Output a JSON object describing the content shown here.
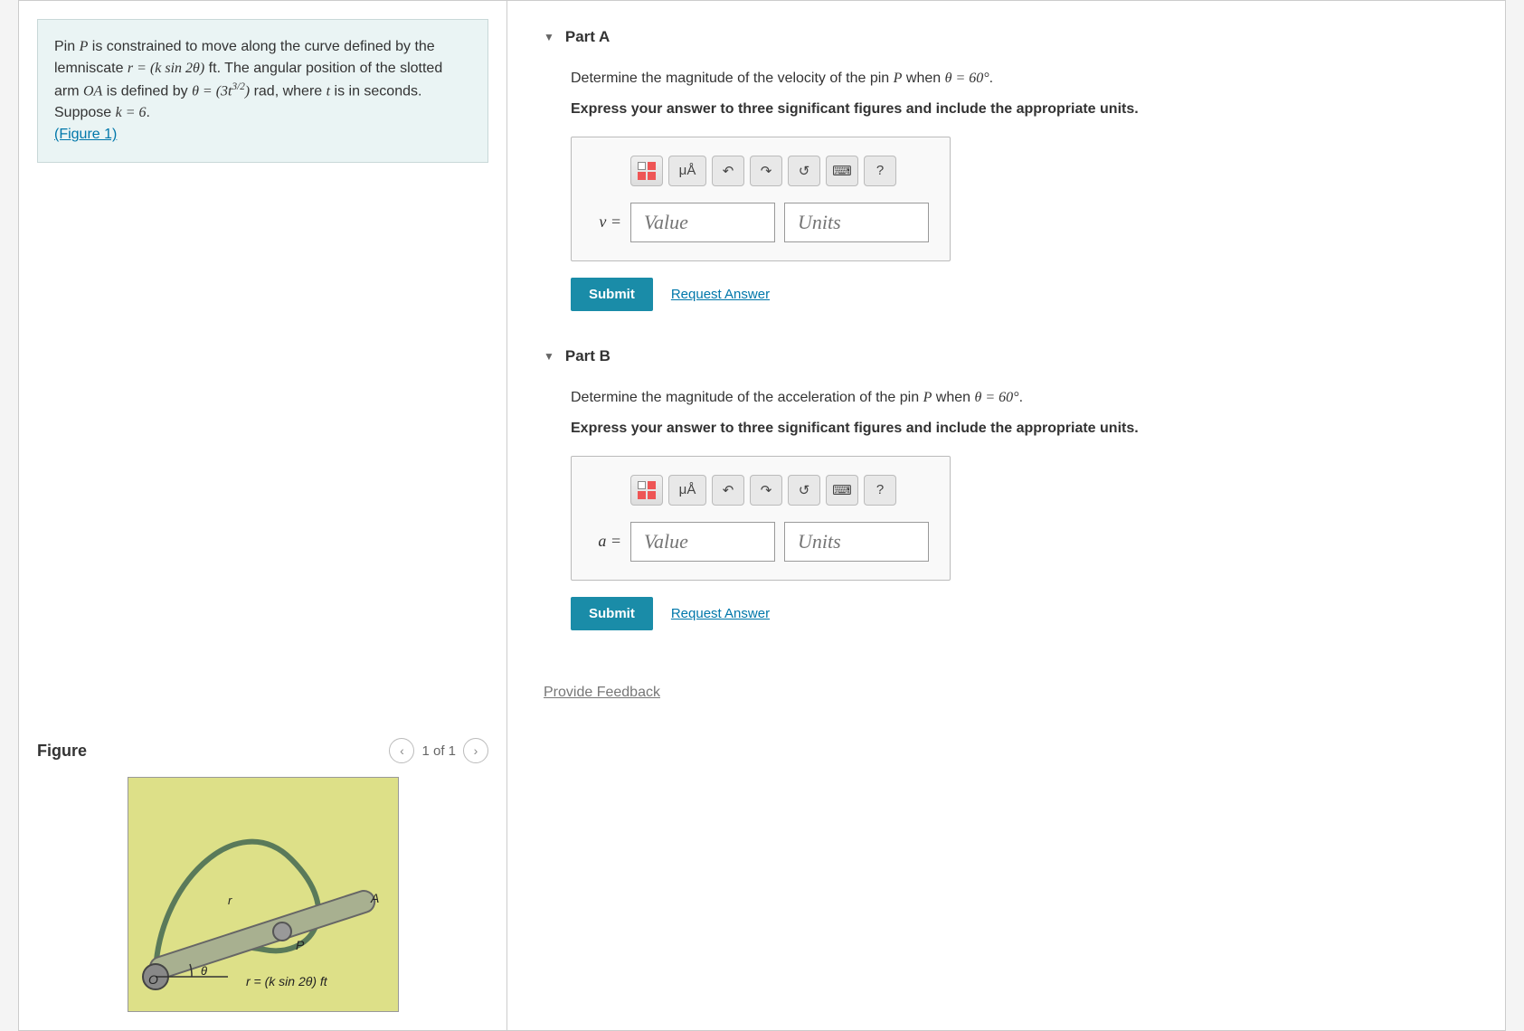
{
  "problem": {
    "text_1": "Pin ",
    "var_P": "P",
    "text_2": " is constrained to move along the curve defined by the lemniscate ",
    "eq_r": "r = (k sin 2θ)",
    "text_3": " ft. The angular position of the slotted arm ",
    "var_OA": "OA",
    "text_4": " is defined by ",
    "eq_theta": "θ = (3t",
    "eq_theta_exp": "3/2",
    "eq_theta_end": ")",
    "text_5": " rad, where ",
    "var_t": "t",
    "text_6": " is in seconds. Suppose ",
    "eq_k": "k = 6",
    "text_7": ".",
    "figure_link": "(Figure 1)"
  },
  "figure": {
    "title": "Figure",
    "counter": "1 of 1",
    "label_A": "A",
    "label_P": "P",
    "label_O": "O",
    "label_theta": "θ",
    "label_r": "r",
    "equation": "r = (k sin 2θ) ft"
  },
  "partA": {
    "header": "Part A",
    "prompt_1": "Determine the magnitude of the velocity of the pin ",
    "prompt_var": "P",
    "prompt_2": " when ",
    "prompt_eq": "θ = 60°",
    "prompt_3": ".",
    "instruction": "Express your answer to three significant figures and include the appropriate units.",
    "var_label": "v =",
    "value_placeholder": "Value",
    "units_placeholder": "Units",
    "submit": "Submit",
    "request": "Request Answer"
  },
  "partB": {
    "header": "Part B",
    "prompt_1": "Determine the magnitude of the acceleration of the pin ",
    "prompt_var": "P",
    "prompt_2": " when ",
    "prompt_eq": "θ = 60°",
    "prompt_3": ".",
    "instruction": "Express your answer to three significant figures and include the appropriate units.",
    "var_label": "a =",
    "value_placeholder": "Value",
    "units_placeholder": "Units",
    "submit": "Submit",
    "request": "Request Answer"
  },
  "toolbar": {
    "units_symbol": "μÅ",
    "help": "?"
  },
  "feedback": "Provide Feedback"
}
